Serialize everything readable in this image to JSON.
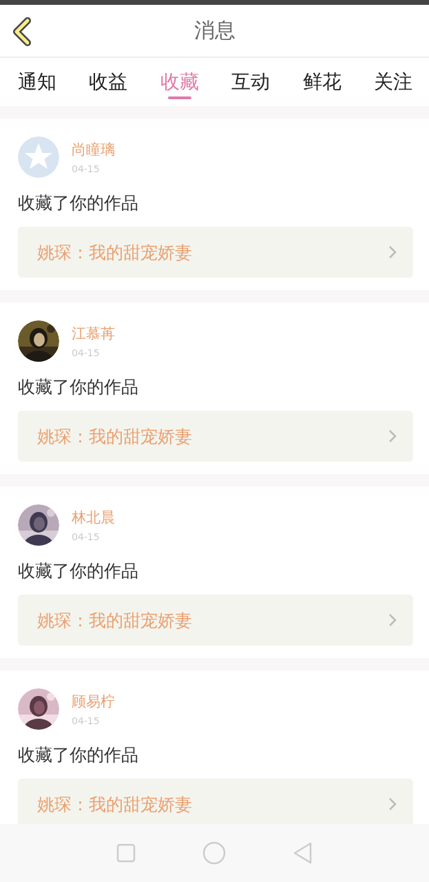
{
  "header": {
    "title": "消息"
  },
  "tabs": [
    {
      "label": "通知",
      "selected": false
    },
    {
      "label": "收益",
      "selected": false
    },
    {
      "label": "收藏",
      "selected": true
    },
    {
      "label": "互动",
      "selected": false
    },
    {
      "label": "鲜花",
      "selected": false
    },
    {
      "label": "关注",
      "selected": false
    }
  ],
  "messages": [
    {
      "kind": "placeholder",
      "name": "尚瞳璃",
      "date": "04-15",
      "action": "收藏了你的作品",
      "work": "姚琛：我的甜宠娇妻"
    },
    {
      "kind": "picture",
      "name": "江慕苒",
      "date": "04-15",
      "action": "收藏了你的作品",
      "work": "姚琛：我的甜宠娇妻"
    },
    {
      "kind": "picture",
      "name": "林北晨",
      "date": "04-15",
      "action": "收藏了你的作品",
      "work": "姚琛：我的甜宠娇妻"
    },
    {
      "kind": "picture",
      "name": "顾易柠",
      "date": "04-15",
      "action": "收藏了你的作品",
      "work": "姚琛：我的甜宠娇妻"
    }
  ]
}
